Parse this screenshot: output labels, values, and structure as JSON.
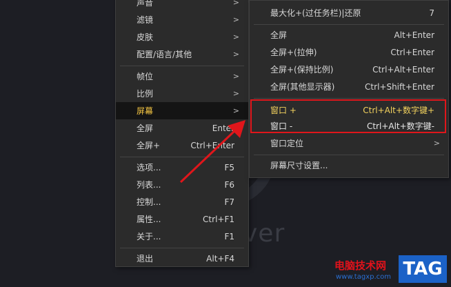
{
  "background": {
    "logo_text": "ver"
  },
  "left_menu": {
    "items": [
      {
        "label": "声音",
        "shortcut": "",
        "arrow": ">"
      },
      {
        "label": "滤镜",
        "shortcut": "",
        "arrow": ">"
      },
      {
        "label": "皮肤",
        "shortcut": "",
        "arrow": ">"
      },
      {
        "label": "配置/语言/其他",
        "shortcut": "",
        "arrow": ">"
      },
      {
        "label": "帧位",
        "shortcut": "",
        "arrow": ">"
      },
      {
        "label": "比例",
        "shortcut": "",
        "arrow": ">"
      },
      {
        "label": "屏幕",
        "shortcut": "",
        "arrow": ">"
      },
      {
        "label": "全屏",
        "shortcut": "Enter",
        "arrow": ""
      },
      {
        "label": "全屏+",
        "shortcut": "Ctrl+Enter",
        "arrow": ""
      },
      {
        "label": "选项...",
        "shortcut": "F5",
        "arrow": ""
      },
      {
        "label": "列表...",
        "shortcut": "F6",
        "arrow": ""
      },
      {
        "label": "控制...",
        "shortcut": "F7",
        "arrow": ""
      },
      {
        "label": "属性...",
        "shortcut": "Ctrl+F1",
        "arrow": ""
      },
      {
        "label": "关于...",
        "shortcut": "F1",
        "arrow": ""
      },
      {
        "label": "退出",
        "shortcut": "Alt+F4",
        "arrow": ""
      }
    ]
  },
  "right_menu": {
    "items": [
      {
        "label": "最大化+(过任务栏)|还原",
        "shortcut": "7",
        "arrow": ""
      },
      {
        "label": "全屏",
        "shortcut": "Alt+Enter",
        "arrow": ""
      },
      {
        "label": "全屏+(拉伸)",
        "shortcut": "Ctrl+Enter",
        "arrow": ""
      },
      {
        "label": "全屏+(保持比例)",
        "shortcut": "Ctrl+Alt+Enter",
        "arrow": ""
      },
      {
        "label": "全屏(其他显示器)",
        "shortcut": "Ctrl+Shift+Enter",
        "arrow": ""
      },
      {
        "label": "窗口 +",
        "shortcut": "Ctrl+Alt+数字键+",
        "arrow": ""
      },
      {
        "label": "窗口 -",
        "shortcut": "Ctrl+Alt+数字键-",
        "arrow": ""
      },
      {
        "label": "窗口定位",
        "shortcut": "",
        "arrow": ">"
      },
      {
        "label": "屏幕尺寸设置...",
        "shortcut": "",
        "arrow": ""
      }
    ]
  },
  "watermark": {
    "site_name": "电脑技术网",
    "url": "www.tagxp.com",
    "tag": "TAG"
  },
  "colors": {
    "highlight": "#f4c542",
    "annotation_red": "#e0161b"
  }
}
